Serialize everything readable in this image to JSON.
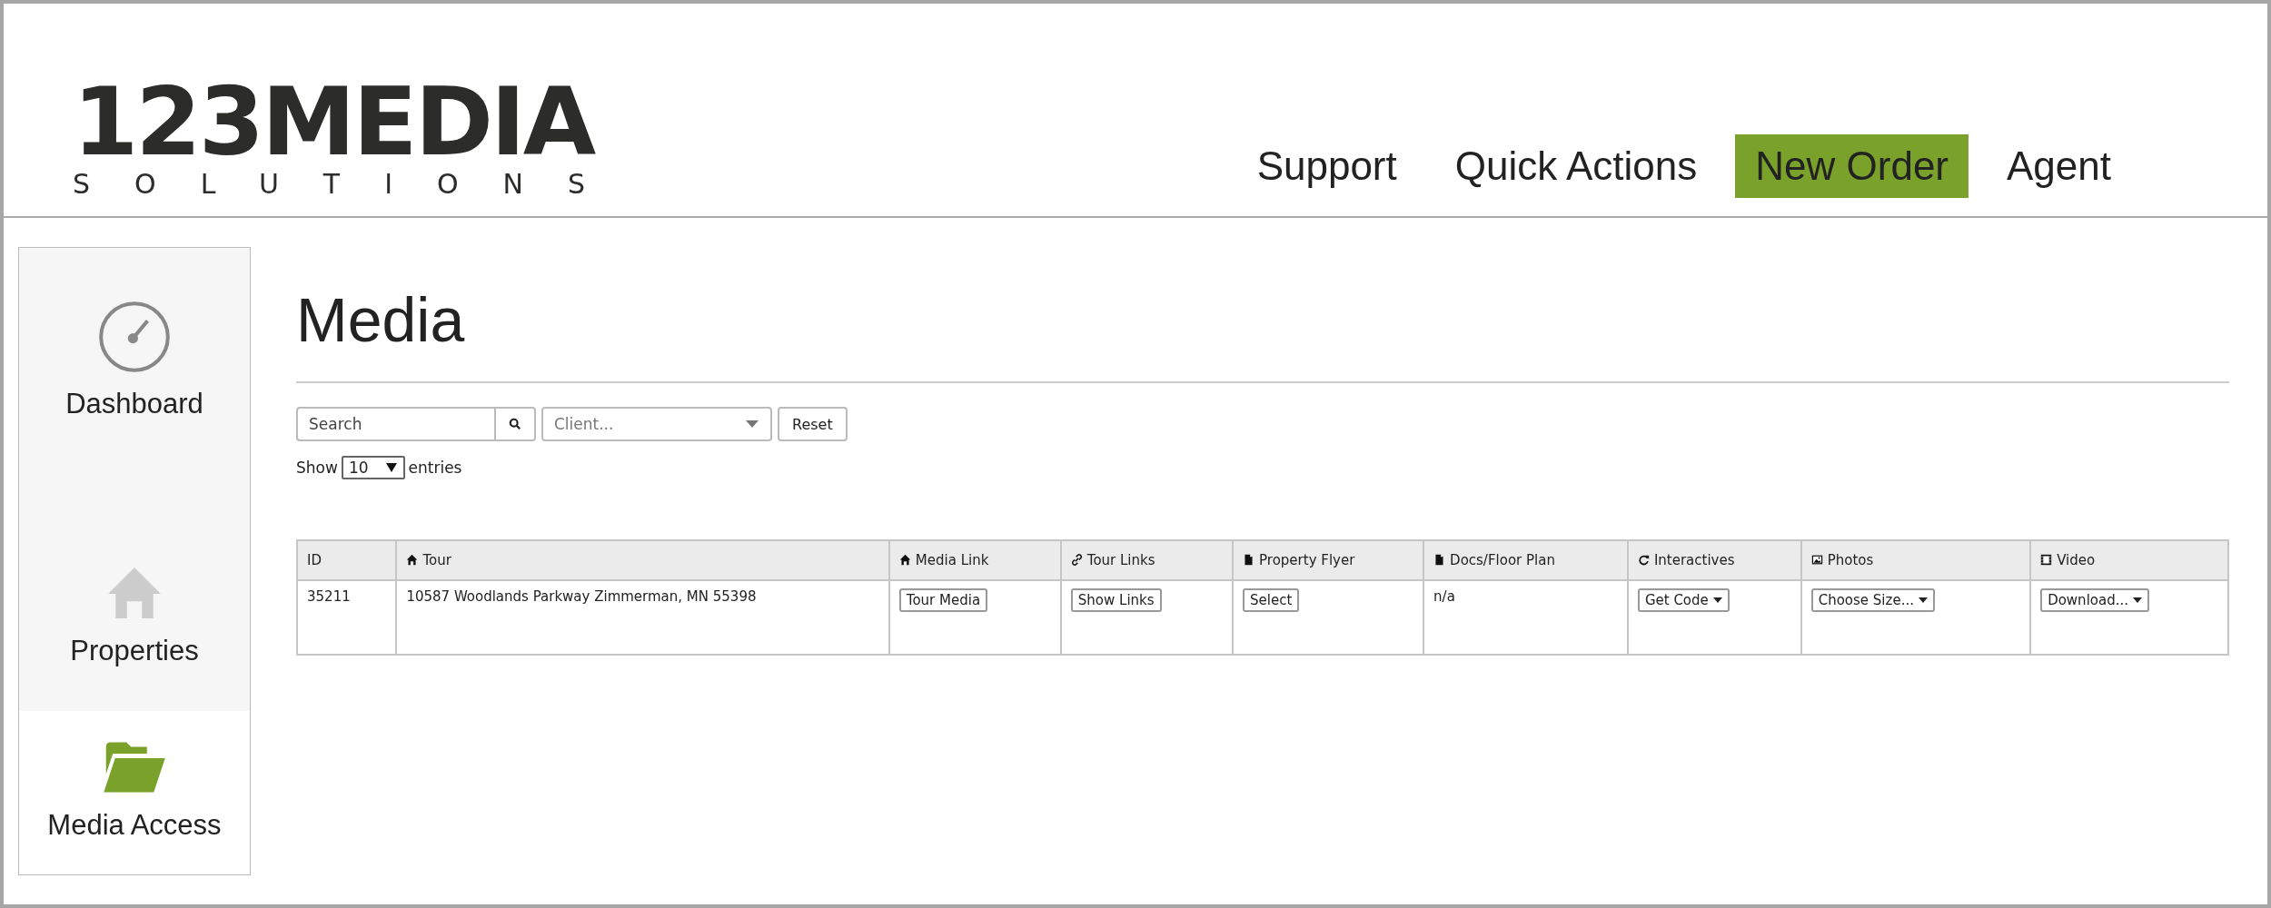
{
  "logo": {
    "title": "123MEDIA",
    "subtitle": "SOLUTIONS"
  },
  "nav": [
    {
      "label": "Support",
      "highlighted": false
    },
    {
      "label": "Quick Actions",
      "highlighted": false
    },
    {
      "label": "New Order",
      "highlighted": true
    },
    {
      "label": "Agent",
      "highlighted": false
    }
  ],
  "sidebar": {
    "items": [
      {
        "label": "Dashboard",
        "selected": false
      },
      {
        "label": "Properties",
        "selected": false
      },
      {
        "label": "Media Access",
        "selected": true
      }
    ]
  },
  "page_title": "Media",
  "filters": {
    "search": {
      "placeholder": "Search"
    },
    "client": {
      "placeholder": "Client..."
    },
    "reset": "Reset"
  },
  "length": {
    "before": "Show",
    "value": "10",
    "after": "entries"
  },
  "table": {
    "columns": [
      "ID",
      "Tour",
      "Media Link",
      "Tour Links",
      "Property Flyer",
      "Docs/Floor Plan",
      "Interactives",
      "Photos",
      "Video"
    ],
    "rows": [
      [
        {
          "kind": "text",
          "text": "35211"
        },
        {
          "kind": "text",
          "text": "10587 Woodlands Parkway Zimmerman, MN 55398"
        },
        {
          "kind": "button",
          "text": "Tour Media"
        },
        {
          "kind": "button",
          "text": "Show Links"
        },
        {
          "kind": "button",
          "text": "Select"
        },
        {
          "kind": "text",
          "text": "n/a"
        },
        {
          "kind": "dropdown",
          "text": "Get Code"
        },
        {
          "kind": "dropdown",
          "text": "Choose Size..."
        },
        {
          "kind": "dropdown",
          "text": "Download..."
        }
      ]
    ]
  }
}
